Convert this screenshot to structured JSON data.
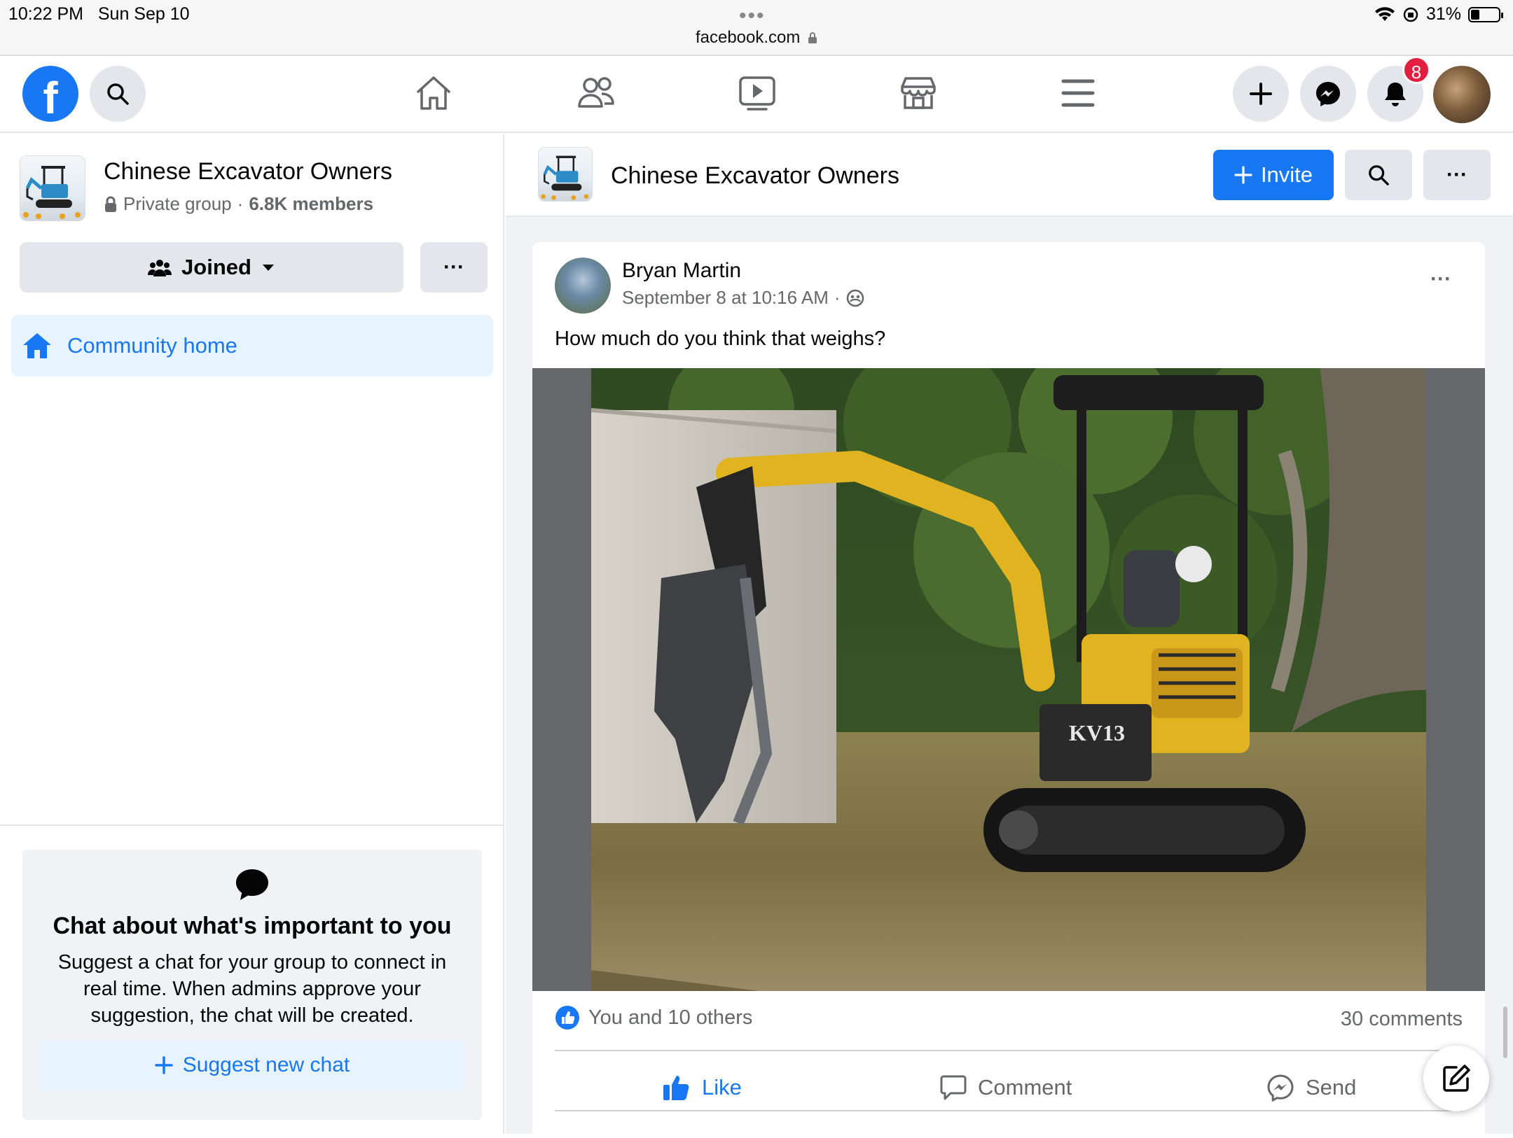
{
  "status_bar": {
    "time": "10:22 PM",
    "date": "Sun Sep 10",
    "url": "facebook.com",
    "battery": "31%",
    "battery_level": 0.31
  },
  "top_nav": {
    "logo": "f",
    "icons": [
      "search-icon",
      "home-icon",
      "friends-icon",
      "watch-icon",
      "marketplace-icon",
      "menu-icon",
      "plus-icon",
      "messenger-icon",
      "bell-icon"
    ],
    "notification_count": "8"
  },
  "sidebar": {
    "group_name": "Chinese Excavator Owners",
    "privacy": "Private group",
    "separator": "·",
    "members": "6.8K members",
    "joined_label": "Joined",
    "more_label": "···",
    "community_home_label": "Community home",
    "chat_card": {
      "title": "Chat about what's important to you",
      "description": "Suggest a chat for your group to connect in real time. When admins approve your suggestion, the chat will be created.",
      "button_label": "Suggest new chat"
    }
  },
  "group_header": {
    "title": "Chinese Excavator Owners",
    "invite_label": "Invite",
    "more_label": "···"
  },
  "post": {
    "author": "Bryan Martin",
    "timestamp": "September 8 at 10:16 AM",
    "meta_separator": "·",
    "more_label": "···",
    "text": "How much do you think that weighs?",
    "photo_label": "KV13",
    "reactions_text": "You and 10 others",
    "comments_text": "30 comments",
    "actions": {
      "like": "Like",
      "comment": "Comment",
      "send": "Send"
    }
  },
  "colors": {
    "brand_blue": "#1877f2",
    "badge_red": "#e41e3f",
    "secondary_text": "#65676b",
    "page_bg": "#f0f2f5"
  }
}
